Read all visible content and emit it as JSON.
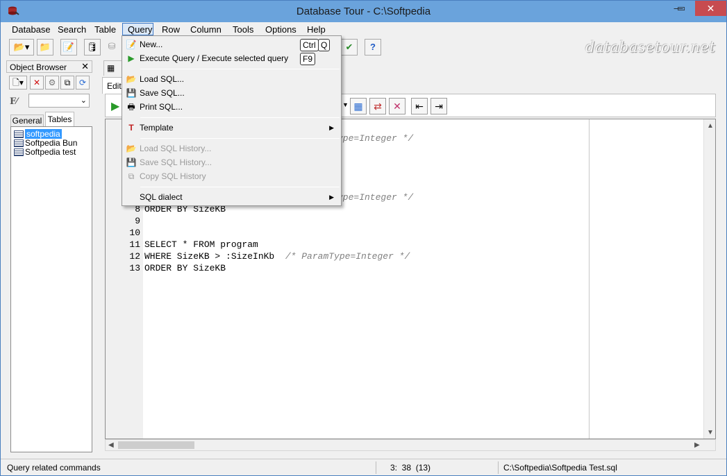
{
  "window": {
    "title": "Database Tour - C:\\Softpedia"
  },
  "menubar": [
    "Database",
    "Search",
    "Table",
    "Query",
    "Row",
    "Column",
    "Tools",
    "Options",
    "Help"
  ],
  "watermark": "databasetour.net",
  "object_browser": {
    "title": "Object Browser",
    "tabs": [
      "General",
      "Tables"
    ],
    "tables": [
      "softpedia",
      "Softpedia Bun",
      "Softpedia test"
    ],
    "selected": "softpedia"
  },
  "editor": {
    "tab": "Edit",
    "lines": [
      {
        "n": "8",
        "code": "ORDER BY SizeKB",
        "comment": ""
      },
      {
        "n": "9",
        "code": "",
        "comment": ""
      },
      {
        "n": "10",
        "code": "",
        "comment": ""
      },
      {
        "n": "11",
        "code": "SELECT * FROM program",
        "comment": ""
      },
      {
        "n": "12",
        "code": "WHERE SizeKB > :SizeInKb  ",
        "comment": "/* ParamType=Integer */"
      },
      {
        "n": "13",
        "code": "ORDER BY SizeKB",
        "comment": ""
      }
    ],
    "partial_comment_1": "ype=Integer */",
    "partial_comment_2": "ype=Integer */"
  },
  "query_menu": {
    "items": [
      {
        "label": "New...",
        "keys": [
          "Ctrl",
          "Q"
        ]
      },
      {
        "label": "Execute Query / Execute selected query",
        "keys": [
          "F9"
        ]
      },
      {
        "label": "Load SQL..."
      },
      {
        "label": "Save SQL..."
      },
      {
        "label": "Print SQL..."
      },
      {
        "label": "Template"
      },
      {
        "label": "Load SQL History..."
      },
      {
        "label": "Save SQL History..."
      },
      {
        "label": "Copy SQL History"
      },
      {
        "label": "SQL dialect"
      }
    ]
  },
  "statusbar": {
    "message": "Query related commands",
    "position": "3:  38  (13)",
    "file": "C:\\Softpedia\\Softpedia Test.sql"
  },
  "colors": {
    "titlebar": "#6aa3dc",
    "close": "#c74b50",
    "selection": "#3399ff",
    "menu_highlight": "#dbe8f7"
  }
}
